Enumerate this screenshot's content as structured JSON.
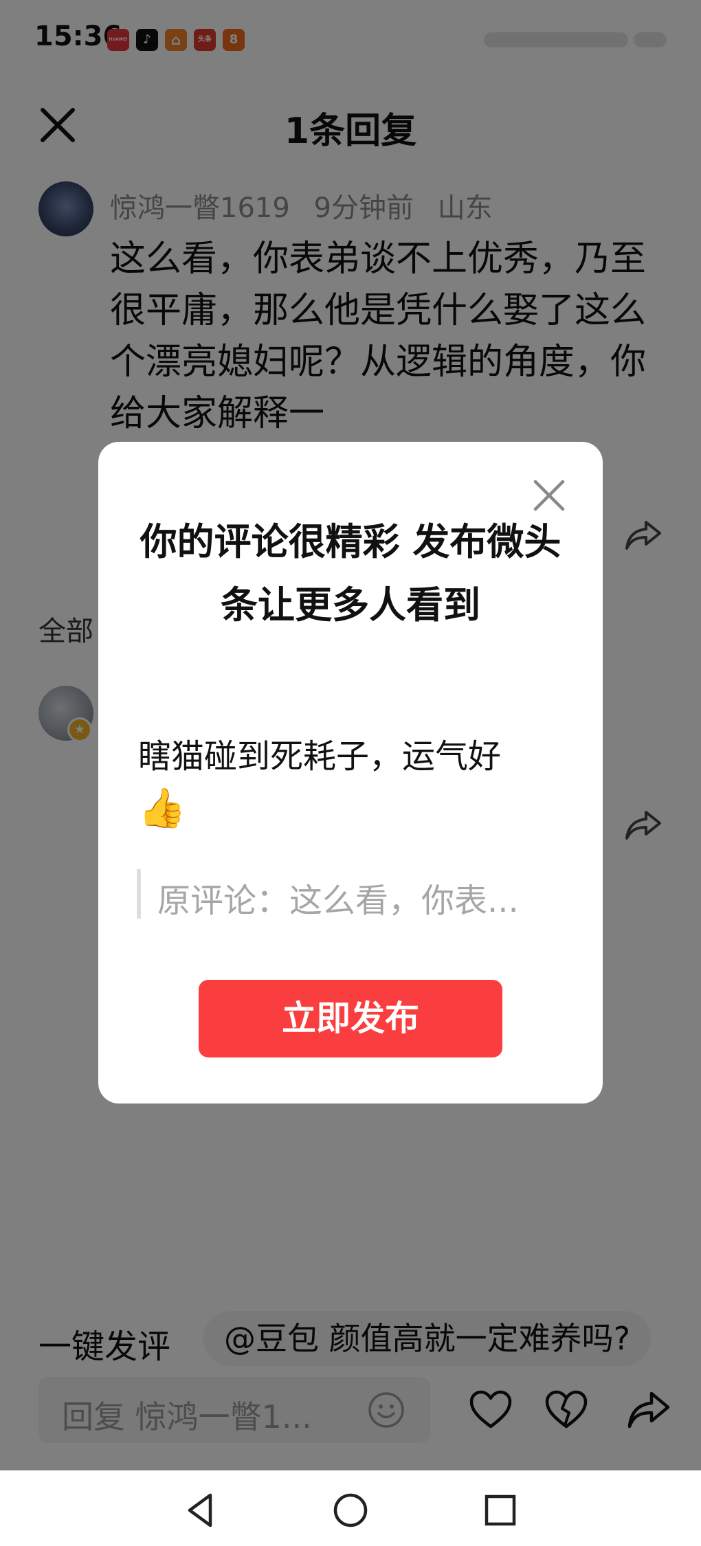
{
  "status_bar": {
    "time": "15:36",
    "apps": [
      {
        "name": "huawei-appgallery",
        "label": "HUAWEI",
        "color": "#e8363d"
      },
      {
        "name": "tiktok",
        "label": "♪",
        "color": "#111111"
      },
      {
        "name": "home-app",
        "label": "⌂",
        "color": "#f5822a"
      },
      {
        "name": "toutiao",
        "label": "头条",
        "color": "#e23a2f"
      },
      {
        "name": "meituan",
        "label": "8",
        "color": "#f26b1d"
      }
    ]
  },
  "sheet": {
    "title": "1条回复",
    "comment": {
      "username": "惊鸿一瞥1619",
      "time_ago": "9分钟前",
      "location": "山东",
      "text": "这么看，你表弟谈不上优秀，乃至很平庸，那么他是凭什么娶了这么个漂亮媳妇呢？从逻辑的角度，你给大家解释一"
    },
    "all_label": "全部"
  },
  "bottom": {
    "quick_comment_label": "一键发评",
    "quick_chip": "@豆包 颜值高就一定难养吗?",
    "reply_placeholder": "回复 惊鸿一瞥1..."
  },
  "modal": {
    "title": "你的评论很精彩 发布微头条让更多人看到",
    "comment_text": "瞎猫碰到死耗子，运气好",
    "comment_emoji": "👍",
    "quote": "原评论：这么看，你表...",
    "publish_label": "立即发布"
  },
  "colors": {
    "accent": "#fa3d3f",
    "overlay": "rgba(0,0,0,0.5)"
  }
}
